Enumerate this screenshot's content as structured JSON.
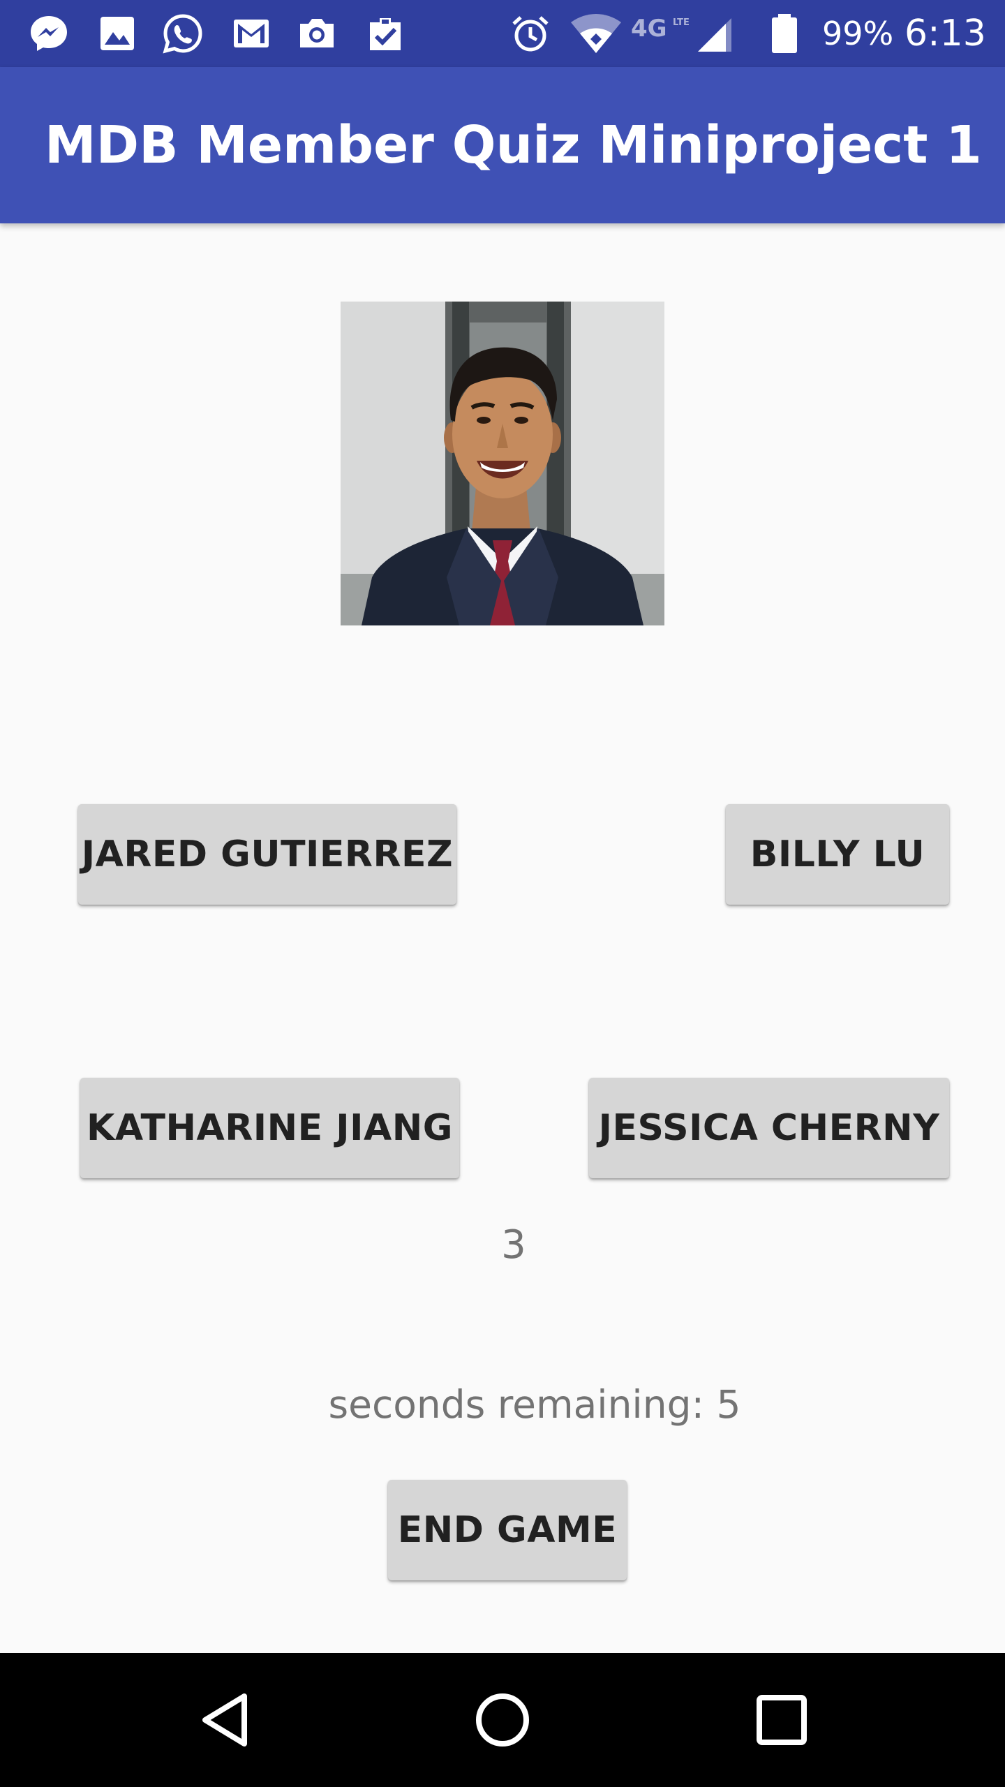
{
  "status_bar": {
    "notification_icons": [
      "messenger-icon",
      "gallery-icon",
      "whatsapp-icon",
      "gmail-icon",
      "camera-icon",
      "clipboard-check-icon"
    ],
    "system_icons": [
      "alarm-icon",
      "wifi-icon",
      "network-4g-lte-icon",
      "cell-signal-icon",
      "battery-icon"
    ],
    "battery_percent": "99%",
    "time": "6:13"
  },
  "app_bar": {
    "title": "MDB Member Quiz Miniproject 1",
    "color": "#3f51b5",
    "status_color": "#303f9f"
  },
  "quiz": {
    "photo_description": "member-photo",
    "options": [
      "JARED GUTIERREZ",
      "BILLY LU",
      "KATHARINE JIANG",
      "JESSICA CHERNY"
    ],
    "score": "3",
    "timer_text": "seconds remaining: 5",
    "end_button": "END GAME"
  },
  "nav_bar": {
    "buttons": [
      "back-icon",
      "home-icon",
      "recents-icon"
    ]
  }
}
